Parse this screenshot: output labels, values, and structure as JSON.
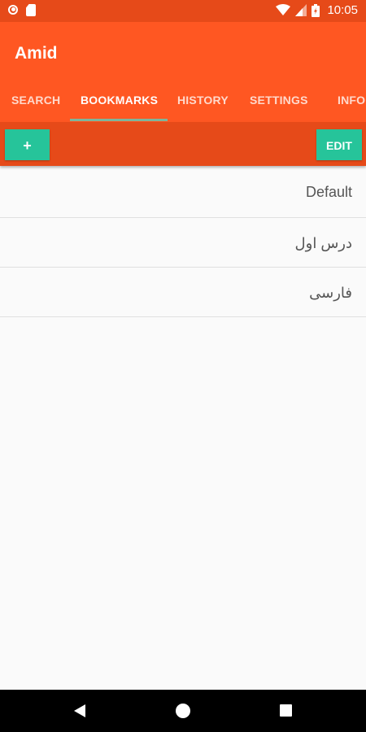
{
  "status_bar": {
    "time": "10:05",
    "icons": [
      "notification-circle-icon",
      "sd-card-icon",
      "wifi-icon",
      "cell-signal-icon",
      "battery-charging-icon"
    ]
  },
  "app": {
    "title": "Amid"
  },
  "tabs": [
    {
      "label": "SEARCH",
      "active": false
    },
    {
      "label": "BOOKMARKS",
      "active": true
    },
    {
      "label": "HISTORY",
      "active": false
    },
    {
      "label": "SETTINGS",
      "active": false
    },
    {
      "label": "INFO",
      "active": false
    }
  ],
  "toolbar": {
    "add_label": "+",
    "edit_label": "EDIT"
  },
  "bookmarks": [
    {
      "label": "Default"
    },
    {
      "label": "درس اول"
    },
    {
      "label": "فارسی"
    }
  ],
  "colors": {
    "app_bar": "#ff5722",
    "status_bar": "#e64a19",
    "accent_button": "#26c49a",
    "tab_indicator": "#7fb59b"
  }
}
